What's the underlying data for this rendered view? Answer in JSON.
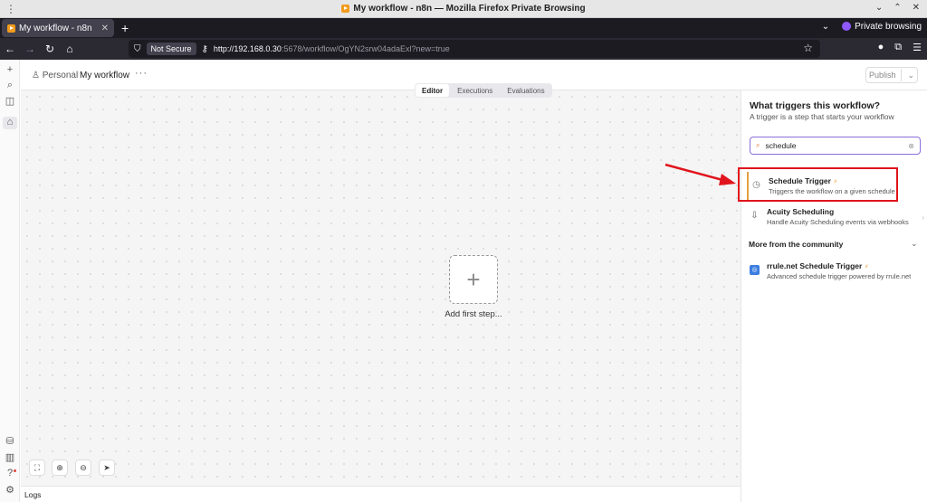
{
  "window": {
    "title": "My workflow - n8n — Mozilla Firefox Private Browsing",
    "controls": [
      "⌄",
      "⌃",
      "✕"
    ]
  },
  "browser": {
    "tab_title": "My workflow - n8n",
    "new_tab": "+",
    "private_label": "Private browsing",
    "not_secure": "Not Secure",
    "url_host": "http://192.168.0.30",
    "url_rest": ":5678/workflow/OgYN2srw04adaExl?new=true"
  },
  "app": {
    "breadcrumb_project": "Personal",
    "breadcrumb_separator": "/",
    "workflow_name": "My workflow",
    "more_menu": "···",
    "publish_label": "Publish",
    "view_tabs": [
      "Editor",
      "Executions",
      "Evaluations"
    ],
    "add_first_step": "Add first step...",
    "add_plus": "+",
    "logs_label": "Logs"
  },
  "panel": {
    "heading": "What triggers this workflow?",
    "subheading": "A trigger is a step that starts your workflow",
    "search_value": "schedule",
    "results": [
      {
        "name": "Schedule Trigger",
        "desc": "Triggers the workflow on a given schedule",
        "icon": "clock-icon",
        "bolt": "⚡"
      },
      {
        "name": "Acuity Scheduling",
        "desc": "Handle Acuity Scheduling events via webhooks",
        "icon": "acuity-icon"
      }
    ],
    "community_heading": "More from the community",
    "community": [
      {
        "name": "rrule.net Schedule Trigger",
        "desc": "Advanced schedule trigger powered by rrule.net",
        "icon": "rrule-icon",
        "bolt": "⚡"
      }
    ]
  },
  "colors": {
    "highlight": "#e0141c",
    "search_border": "#8b6dd9",
    "bolt": "#e8a33a"
  }
}
